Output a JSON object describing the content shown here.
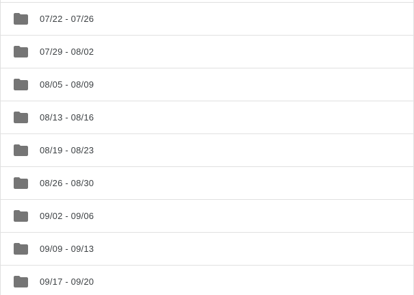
{
  "folder_list": {
    "icon": "folder-icon",
    "icon_color": "#757575",
    "items": [
      {
        "label": "07/22 - 07/26"
      },
      {
        "label": "07/29 - 08/02"
      },
      {
        "label": "08/05 - 08/09"
      },
      {
        "label": "08/13 - 08/16"
      },
      {
        "label": "08/19 - 08/23"
      },
      {
        "label": "08/26 - 08/30"
      },
      {
        "label": "09/02 - 09/06"
      },
      {
        "label": "09/09 - 09/13"
      },
      {
        "label": "09/17 - 09/20"
      }
    ]
  }
}
